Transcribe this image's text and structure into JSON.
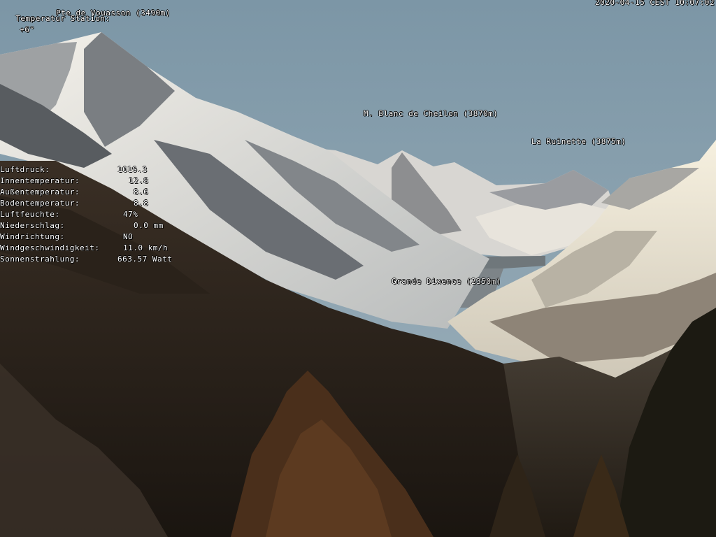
{
  "overlay": {
    "station_label": "Temperatur Station:",
    "station_temp": "+6°",
    "timestamp": "2020-04-15 CEST 10:07:02"
  },
  "peaks": [
    {
      "id": "pte-de-vouasson",
      "label": "Pte de Vouasson (3490m)"
    },
    {
      "id": "m-blanc-de-cheilon",
      "label": "M. Blanc de Cheilon (3870m)"
    },
    {
      "id": "la-ruinette",
      "label": "La Ruinette (3875m)"
    },
    {
      "id": "grande-dixence",
      "label": "Grande Dixence (2350m)"
    }
  ],
  "weather": [
    {
      "label": "Luftdruck:",
      "value": "1019.3"
    },
    {
      "label": "Innentemperatur:",
      "value": "12.8"
    },
    {
      "label": "Außentemperatur:",
      "value": "8.6"
    },
    {
      "label": "Bodentemperatur:",
      "value": "8.8"
    },
    {
      "label": "Luftfeuchte:",
      "value": "47%"
    },
    {
      "label": "Niederschlag:",
      "value": "0.0 mm"
    },
    {
      "label": "Windrichtung:",
      "value": "NO"
    },
    {
      "label": "Windgeschwindigkeit:",
      "value": "11.0 km/h"
    },
    {
      "label": "Sonnenstrahlung:",
      "value": "663.57 Watt"
    }
  ]
}
